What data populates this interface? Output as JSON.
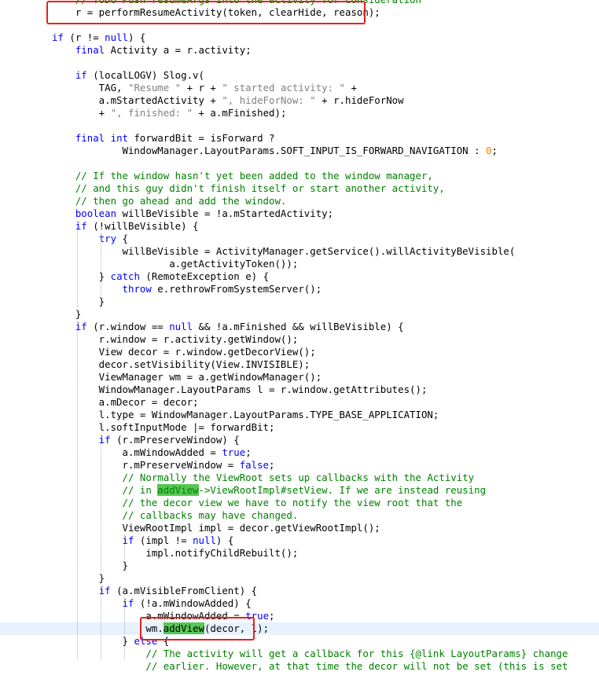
{
  "editor": {
    "lines": [
      [
        {
          "t": "    "
        },
        {
          "t": "// TODO Push resumeArgs into the activity for consideration",
          "c": "cm"
        }
      ],
      [
        {
          "t": "    r = performResumeActivity(token, clearHide, reason);"
        }
      ],
      [
        {
          "t": ""
        }
      ],
      [
        {
          "t": "if",
          "c": "kw"
        },
        {
          "t": " (r != "
        },
        {
          "t": "null",
          "c": "kw"
        },
        {
          "t": ") {"
        }
      ],
      [
        {
          "t": "    "
        },
        {
          "t": "final",
          "c": "kw"
        },
        {
          "t": " Activity a = r.activity;"
        }
      ],
      [
        {
          "t": ""
        }
      ],
      [
        {
          "t": "    "
        },
        {
          "t": "if",
          "c": "kw"
        },
        {
          "t": " (localLOGV) Slog.v("
        }
      ],
      [
        {
          "t": "        TAG, "
        },
        {
          "t": "\"Resume \"",
          "c": "str"
        },
        {
          "t": " + r + "
        },
        {
          "t": "\" started activity: \"",
          "c": "str"
        },
        {
          "t": " +"
        }
      ],
      [
        {
          "t": "        a.mStartedActivity + "
        },
        {
          "t": "\", hideForNow: \"",
          "c": "str"
        },
        {
          "t": " + r.hideForNow"
        }
      ],
      [
        {
          "t": "        + "
        },
        {
          "t": "\", finished: \"",
          "c": "str"
        },
        {
          "t": " + a.mFinished);"
        }
      ],
      [
        {
          "t": ""
        }
      ],
      [
        {
          "t": "    "
        },
        {
          "t": "final",
          "c": "kw"
        },
        {
          "t": " "
        },
        {
          "t": "int",
          "c": "kw"
        },
        {
          "t": " forwardBit = isForward ?"
        }
      ],
      [
        {
          "t": "            WindowManager.LayoutParams.SOFT_INPUT_IS_FORWARD_NAVIGATION : "
        },
        {
          "t": "0",
          "c": "num"
        },
        {
          "t": ";"
        }
      ],
      [
        {
          "t": ""
        }
      ],
      [
        {
          "t": "    "
        },
        {
          "t": "// If the window hasn't yet been added to the window manager,",
          "c": "cm"
        }
      ],
      [
        {
          "t": "    "
        },
        {
          "t": "// and this guy didn't finish itself or start another activity,",
          "c": "cm"
        }
      ],
      [
        {
          "t": "    "
        },
        {
          "t": "// then go ahead and add the window.",
          "c": "cm"
        }
      ],
      [
        {
          "t": "    "
        },
        {
          "t": "boolean",
          "c": "kw"
        },
        {
          "t": " willBeVisible = !a.mStartedActivity;"
        }
      ],
      [
        {
          "t": "    "
        },
        {
          "t": "if",
          "c": "kw"
        },
        {
          "t": " (!willBeVisible) {"
        }
      ],
      [
        {
          "t": "        "
        },
        {
          "t": "try",
          "c": "kw"
        },
        {
          "t": " {"
        }
      ],
      [
        {
          "t": "            willBeVisible = ActivityManager.getService().willActivityBeVisible("
        }
      ],
      [
        {
          "t": "                    a.getActivityToken());"
        }
      ],
      [
        {
          "t": "        } "
        },
        {
          "t": "catch",
          "c": "kw"
        },
        {
          "t": " (RemoteException e) {"
        }
      ],
      [
        {
          "t": "            "
        },
        {
          "t": "throw",
          "c": "kw"
        },
        {
          "t": " e.rethrowFromSystemServer();"
        }
      ],
      [
        {
          "t": "        }"
        }
      ],
      [
        {
          "t": "    }"
        }
      ],
      [
        {
          "t": "    "
        },
        {
          "t": "if",
          "c": "kw"
        },
        {
          "t": " (r.window == "
        },
        {
          "t": "null",
          "c": "kw"
        },
        {
          "t": " && !a.mFinished && willBeVisible) {"
        }
      ],
      [
        {
          "t": "        r.window = r.activity.getWindow();"
        }
      ],
      [
        {
          "t": "        View decor = r.window.getDecorView();"
        }
      ],
      [
        {
          "t": "        decor.setVisibility(View.INVISIBLE);"
        }
      ],
      [
        {
          "t": "        ViewManager wm = a.getWindowManager();"
        }
      ],
      [
        {
          "t": "        WindowManager.LayoutParams l = r.window.getAttributes();"
        }
      ],
      [
        {
          "t": "        a.mDecor = decor;"
        }
      ],
      [
        {
          "t": "        l.type = WindowManager.LayoutParams.TYPE_BASE_APPLICATION;"
        }
      ],
      [
        {
          "t": "        l.softInputMode |= forwardBit;"
        }
      ],
      [
        {
          "t": "        "
        },
        {
          "t": "if",
          "c": "kw"
        },
        {
          "t": " (r.mPreserveWindow) {"
        }
      ],
      [
        {
          "t": "            a.mWindowAdded = "
        },
        {
          "t": "true",
          "c": "kw"
        },
        {
          "t": ";"
        }
      ],
      [
        {
          "t": "            r.mPreserveWindow = "
        },
        {
          "t": "false",
          "c": "kw"
        },
        {
          "t": ";"
        }
      ],
      [
        {
          "t": "            "
        },
        {
          "t": "// Normally the ViewRoot sets up callbacks with the Activity",
          "c": "cm"
        }
      ],
      [
        {
          "t": "            "
        },
        {
          "t": "// in ",
          "c": "cm"
        },
        {
          "t": "addView",
          "c": "cm hl"
        },
        {
          "t": "->ViewRootImpl#setView. If we are instead reusing",
          "c": "cm"
        }
      ],
      [
        {
          "t": "            "
        },
        {
          "t": "// the decor view we have to notify the view root that the",
          "c": "cm"
        }
      ],
      [
        {
          "t": "            "
        },
        {
          "t": "// callbacks may have changed.",
          "c": "cm"
        }
      ],
      [
        {
          "t": "            ViewRootImpl impl = decor.getViewRootImpl();"
        }
      ],
      [
        {
          "t": "            "
        },
        {
          "t": "if",
          "c": "kw"
        },
        {
          "t": " (impl != "
        },
        {
          "t": "null",
          "c": "kw"
        },
        {
          "t": ") {"
        }
      ],
      [
        {
          "t": "                impl.notifyChildRebuilt();"
        }
      ],
      [
        {
          "t": "            }"
        }
      ],
      [
        {
          "t": "        }"
        }
      ],
      [
        {
          "t": "        "
        },
        {
          "t": "if",
          "c": "kw"
        },
        {
          "t": " (a.mVisibleFromClient) {"
        }
      ],
      [
        {
          "t": "            "
        },
        {
          "t": "if",
          "c": "kw"
        },
        {
          "t": " (!a.mWindowAdded) {"
        }
      ],
      [
        {
          "t": "                a.mWindowAdded = "
        },
        {
          "t": "true",
          "c": "kw"
        },
        {
          "t": ";"
        }
      ],
      [
        {
          "t": "                wm."
        },
        {
          "t": "addView",
          "c": "hl"
        },
        {
          "t": "(decor, l);"
        }
      ],
      [
        {
          "t": "            } "
        },
        {
          "t": "else",
          "c": "kw"
        },
        {
          "t": " {"
        }
      ],
      [
        {
          "t": "                "
        },
        {
          "t": "// The activity will get a callback for this {@link LayoutParams} change",
          "c": "cm"
        }
      ],
      [
        {
          "t": "                "
        },
        {
          "t": "// earlier. However, at that time the decor will not be set (this is set",
          "c": "cm"
        }
      ]
    ],
    "current_line": 50,
    "guides": [
      {
        "col": 4,
        "from": 18,
        "to": 25
      },
      {
        "col": 8,
        "from": 19,
        "to": 24
      },
      {
        "col": 4,
        "from": 26,
        "to": 53
      },
      {
        "col": 8,
        "from": 35,
        "to": 46
      },
      {
        "col": 12,
        "from": 43,
        "to": 45
      },
      {
        "col": 8,
        "from": 47,
        "to": 53
      },
      {
        "col": 12,
        "from": 48,
        "to": 51
      },
      {
        "col": 12,
        "from": 51,
        "to": 53
      }
    ],
    "annotations": [
      {
        "line": 1,
        "colStart": -1,
        "colEnd": 53
      },
      {
        "line": 50,
        "colStart": 15,
        "colEnd": 34
      }
    ],
    "colors": {
      "keyword": "#0000ff",
      "string": "#808080",
      "comment": "#008000",
      "number": "#ff8000",
      "highlight": "#55c855",
      "current_line": "#e8f2fe",
      "annotation": "#e8201c"
    }
  }
}
